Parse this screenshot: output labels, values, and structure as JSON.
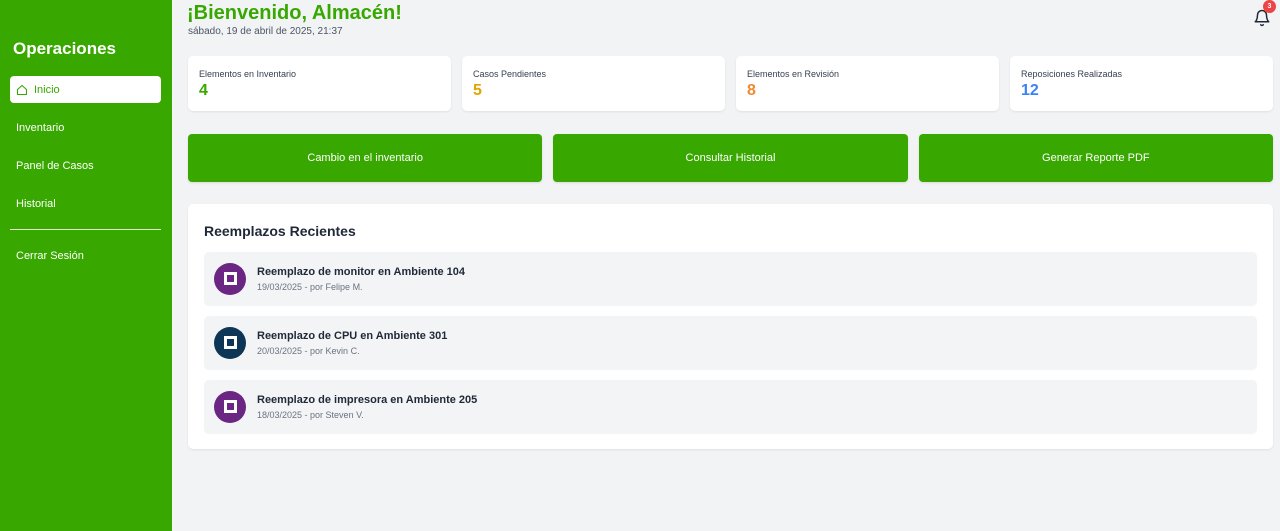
{
  "sidebar": {
    "brand": "Operaciones",
    "items": [
      {
        "label": "Inicio",
        "active": true,
        "icon": "home-icon"
      },
      {
        "label": "Inventario"
      },
      {
        "label": "Panel de Casos"
      },
      {
        "label": "Historial"
      }
    ],
    "logout": "Cerrar Sesión"
  },
  "header": {
    "title": "¡Bienvenido, Almacén!",
    "date": "sábado, 19 de abril de 2025, 21:37",
    "notifications_count": "3"
  },
  "stats": [
    {
      "label": "Elementos en Inventario",
      "value": "4",
      "color": "#38a800"
    },
    {
      "label": "Casos Pendientes",
      "value": "5",
      "color": "#e2a400"
    },
    {
      "label": "Elementos en Revisión",
      "value": "8",
      "color": "#ef8a2f"
    },
    {
      "label": "Reposiciones Realizadas",
      "value": "12",
      "color": "#3b82f6"
    }
  ],
  "actions": [
    {
      "label": "Cambio en el inventario"
    },
    {
      "label": "Consultar Historial"
    },
    {
      "label": "Generar Reporte PDF"
    }
  ],
  "recent": {
    "title": "Reemplazos Recientes",
    "items": [
      {
        "title": "Reemplazo de monitor en Ambiente 104",
        "sub": "19/03/2025 - por Felipe M.",
        "color": "#6b2583"
      },
      {
        "title": "Reemplazo de CPU en Ambiente 301",
        "sub": "20/03/2025 - por Kevin C.",
        "color": "#0c3556"
      },
      {
        "title": "Reemplazo de impresora en Ambiente 205",
        "sub": "18/03/2025 - por Steven V.",
        "color": "#6b2583"
      }
    ]
  },
  "colors": {
    "brand_green": "#38a800",
    "background": "#f2f3f5"
  }
}
